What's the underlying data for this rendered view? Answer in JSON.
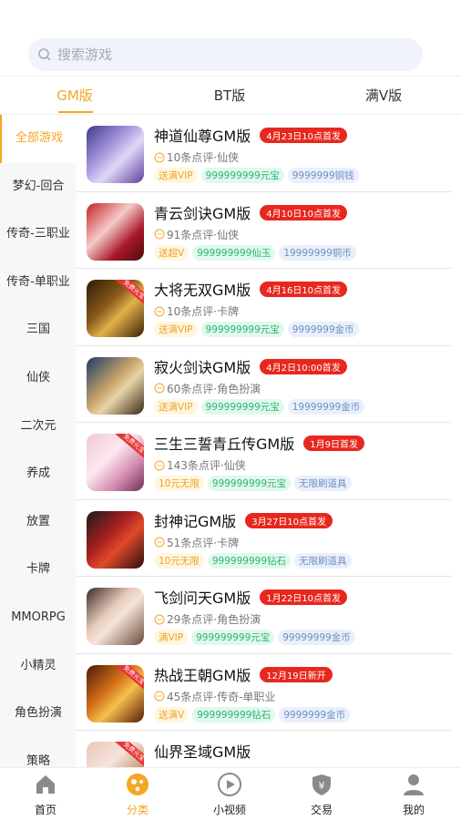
{
  "search": {
    "placeholder": "搜索游戏"
  },
  "tabs": [
    {
      "label": "GM版"
    },
    {
      "label": "BT版"
    },
    {
      "label": "满V版"
    }
  ],
  "sidebar": {
    "items": [
      {
        "label": "全部游戏"
      },
      {
        "label": "梦幻-回合"
      },
      {
        "label": "传奇-三职业"
      },
      {
        "label": "传奇-单职业"
      },
      {
        "label": "三国"
      },
      {
        "label": "仙侠"
      },
      {
        "label": "二次元"
      },
      {
        "label": "养成"
      },
      {
        "label": "放置"
      },
      {
        "label": "卡牌"
      },
      {
        "label": "MMORPG"
      },
      {
        "label": "小精灵"
      },
      {
        "label": "角色扮演"
      },
      {
        "label": "策略"
      }
    ]
  },
  "games": [
    {
      "name": "神道仙尊GM版",
      "date": "4月23日10点首发",
      "meta": "10条点评·仙侠",
      "tags": [
        "送满VIP",
        "999999999元宝",
        "9999999铜钱"
      ],
      "ribbon": ""
    },
    {
      "name": "青云剑诀GM版",
      "date": "4月10日10点首发",
      "meta": "91条点评·仙侠",
      "tags": [
        "送超V",
        "999999999仙玉",
        "19999999铜币"
      ],
      "ribbon": ""
    },
    {
      "name": "大将无双GM版",
      "date": "4月16日10点首发",
      "meta": "10条点评·卡牌",
      "tags": [
        "送满VIP",
        "999999999元宝",
        "9999999金币"
      ],
      "ribbon": "免费元宝"
    },
    {
      "name": "寂火剑诀GM版",
      "date": "4月2日10:00首发",
      "meta": "60条点评·角色扮演",
      "tags": [
        "送满VIP",
        "999999999元宝",
        "19999999金币"
      ],
      "ribbon": ""
    },
    {
      "name": "三生三誓青丘传GM版",
      "date": "1月9日首发",
      "meta": "143条点评·仙侠",
      "tags": [
        "10元无限",
        "999999999元宝",
        "无限刷道具"
      ],
      "ribbon": "免费元宝"
    },
    {
      "name": "封神记GM版",
      "date": "3月27日10点首发",
      "meta": "51条点评·卡牌",
      "tags": [
        "10元无限",
        "999999999钻石",
        "无限刷道具"
      ],
      "ribbon": ""
    },
    {
      "name": "飞剑问天GM版",
      "date": "1月22日10点首发",
      "meta": "29条点评·角色扮演",
      "tags": [
        "满VIP",
        "999999999元宝",
        "99999999金币"
      ],
      "ribbon": ""
    },
    {
      "name": "热战王朝GM版",
      "date": "12月19日新开",
      "meta": "45条点评·传奇-单职业",
      "tags": [
        "送满V",
        "999999999钻石",
        "9999999金币"
      ],
      "ribbon": "免费元宝"
    },
    {
      "name": "仙界圣域GM版",
      "date": "",
      "meta": "",
      "tags": [],
      "ribbon": "免费元宝"
    }
  ],
  "bottom_nav": [
    {
      "label": "首页",
      "icon": "home-icon"
    },
    {
      "label": "分类",
      "icon": "category-icon"
    },
    {
      "label": "小视频",
      "icon": "video-icon"
    },
    {
      "label": "交易",
      "icon": "trade-icon"
    },
    {
      "label": "我的",
      "icon": "profile-icon"
    }
  ],
  "colors": {
    "accent": "#f5a623",
    "date_badge": "#e8271e"
  }
}
